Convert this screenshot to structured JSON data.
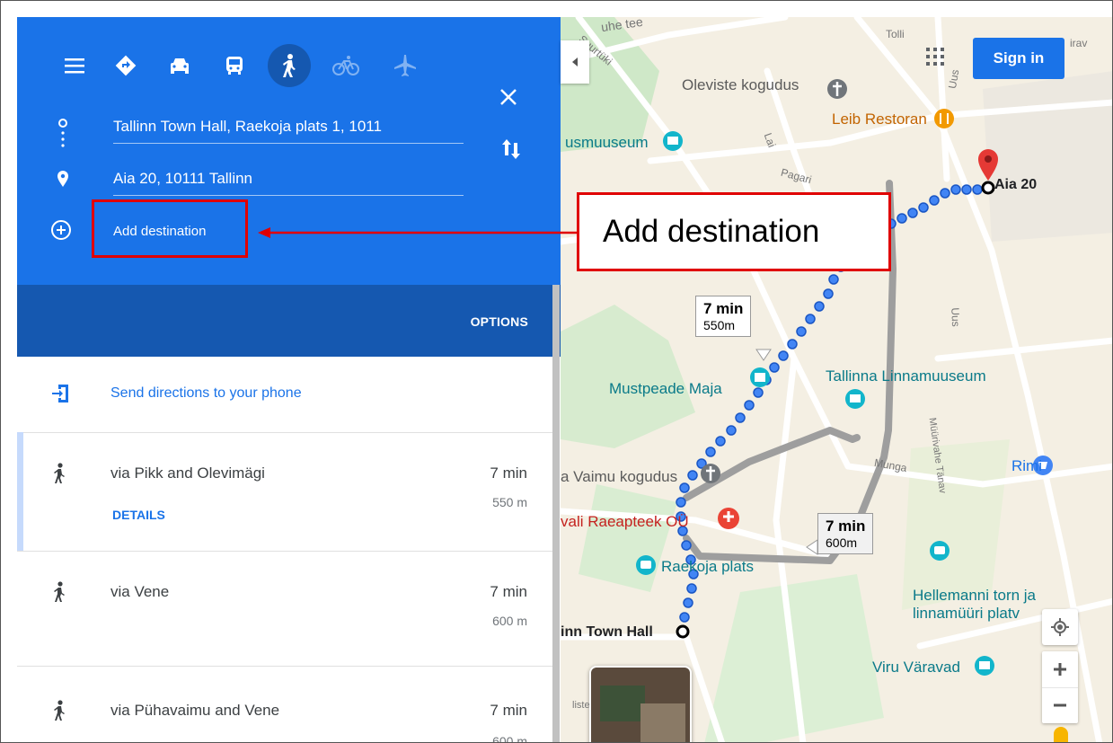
{
  "directions": {
    "origin": "Tallinn Town Hall, Raekoja plats 1, 1011",
    "destination": "Aia 20, 10111 Tallinn",
    "add_destination": "Add destination",
    "options_label": "OPTIONS",
    "send_to_phone": "Send directions to your phone",
    "routes": [
      {
        "title": "via Pikk and Olevimägi",
        "time": "7 min",
        "distance": "550 m",
        "details": "DETAILS"
      },
      {
        "title": "via Vene",
        "time": "7 min",
        "distance": "600 m"
      },
      {
        "title": "via Pühavaimu and Vene",
        "time": "7 min",
        "distance": "600 m"
      }
    ]
  },
  "map": {
    "sign_in": "Sign in",
    "labels": {
      "oleviste": "Oleviste kogudus",
      "leib": "Leib Restoran",
      "museum": "usmuuseum",
      "aia20": "Aia 20",
      "mustpeade": "Mustpeade Maja",
      "linnamuuseum": "Tallinna Linnamuuseum",
      "vaimu": "a Vaimu kogudus",
      "raeapteek": "vali Raeapteek OÜ",
      "raekoja": "Raekoja plats",
      "rimi": "Rimi",
      "hellemanni1": "Hellemanni torn ja",
      "hellemanni2": "linnamüüri platv",
      "town_hall": "inn Town Hall",
      "viru": "Viru Väravad",
      "tolli": "Tolli",
      "pagari": "Pagari",
      "lai": "Lai",
      "uus1": "Uus",
      "uus2": "Uus",
      "munga": "Munga",
      "muurivahe": "Müürivahe Tänav",
      "top_road": "uhe tee",
      "suurtuki": "Suurtüki",
      "tee2": "irav",
      "liiste": "liste"
    },
    "tip1": {
      "time": "7 min",
      "distance": "550m"
    },
    "tip2": {
      "time": "7 min",
      "distance": "600m"
    }
  },
  "annotation": {
    "callout": "Add destination"
  },
  "colors": {
    "panel_blue": "#1a73e8",
    "options_blue": "#1558b0",
    "callout_red": "#e00000",
    "route_blue": "#4285f4"
  }
}
